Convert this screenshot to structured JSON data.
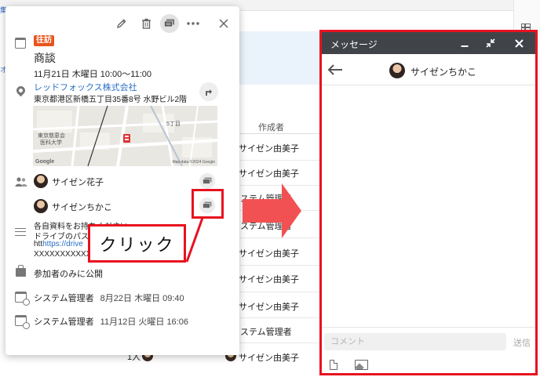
{
  "background": {
    "column_header": "作成者",
    "edge_glyph": "集",
    "edge_glyph_2": "オ",
    "rows": [
      {
        "name": "サイゼン由美子"
      },
      {
        "name": "サイゼン由美子"
      },
      {
        "name": "ステム管理者"
      },
      {
        "name": "ステム管理者"
      },
      {
        "name": "サイゼン由美子"
      },
      {
        "name": "サイゼン由美子"
      },
      {
        "name": "サイゼン由美子"
      },
      {
        "name": "ステム管理者"
      },
      {
        "name": "サイゼン由美子"
      }
    ],
    "count_label": "1人"
  },
  "popup": {
    "tag": "往訪",
    "title": "商談",
    "datetime": "11月21日 木曜日 10:00〜11:00",
    "company": "レッドフォックス株式会社",
    "address": "東京都港区新橋五丁目35番8号 水野ビル2階",
    "map": {
      "label_1": "東京慈恵会",
      "label_2": "医科大学",
      "label_3": "5丁目",
      "attribution": "Map data ©2024 Google",
      "google": "Google"
    },
    "attendees": [
      {
        "name": "サイゼン花子"
      },
      {
        "name": "サイゼンちかこ"
      }
    ],
    "memo": {
      "line1": "各自資料をお持ちください",
      "line2": "ドライブのパス",
      "line3_prefix": " htt",
      "line3_link": "https://drive",
      "line4": "XXXXXXXXXXX"
    },
    "visibility": "参加者のみに公開",
    "history": [
      {
        "user": "システム管理者",
        "timestamp": "8月22日 木曜日 09:40"
      },
      {
        "user": "システム管理者",
        "timestamp": "11月12日 火曜日 16:06"
      }
    ]
  },
  "annotation": {
    "click_label": "クリック",
    "color": "#e8121f",
    "arrow_color": "#f15152"
  },
  "message_window": {
    "title": "メッセージ",
    "user_name": "サイゼンちかこ",
    "comment_placeholder": "コメント",
    "send_label": "送信",
    "header_color": "#404449"
  },
  "icons": {
    "edit": "pencil-icon",
    "delete": "trash-icon",
    "chat": "chat-icon",
    "more": "more-icon",
    "close": "close-icon"
  }
}
